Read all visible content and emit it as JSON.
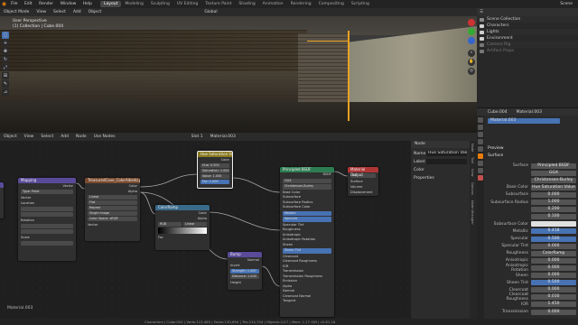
{
  "topbar": {
    "menus": [
      "File",
      "Edit",
      "Render",
      "Window",
      "Help"
    ],
    "tabs": [
      "Layout",
      "Modeling",
      "Sculpting",
      "UV Editing",
      "Texture Paint",
      "Shading",
      "Animation",
      "Rendering",
      "Compositing",
      "Scripting"
    ],
    "active_tab": "Layout",
    "scene": "Scene"
  },
  "viewport": {
    "mode": "Object Mode",
    "menus": [
      "View",
      "Select",
      "Add",
      "Object"
    ],
    "orientation": "Global",
    "label": "User Perspective",
    "label2": "(1) Collection | Cube.004"
  },
  "outliner": {
    "title": "Scene Collection",
    "items": [
      {
        "name": "Scene Collection",
        "color": "#8a8a8a"
      },
      {
        "name": "Characters",
        "color": "#d0d0d0"
      },
      {
        "name": "Lights",
        "color": "#d0d0d0"
      },
      {
        "name": "Environment",
        "color": "#d0d0d0"
      },
      {
        "name": "Camera Rig",
        "color": "#777777"
      },
      {
        "name": "Artifact Props",
        "color": "#777777"
      }
    ]
  },
  "properties": {
    "object": "Cube.004",
    "material": "Material.003",
    "slot": "Material.003",
    "surface_label": "Surface",
    "preview_label": "Preview",
    "rows": [
      {
        "label": "Surface",
        "value": "Principled BSDF",
        "style": "plain"
      },
      {
        "label": "",
        "value": "GGX",
        "style": "plain"
      },
      {
        "label": "",
        "value": "Christensen-Burley",
        "style": "plain"
      },
      {
        "label": "Base Color",
        "value": "Hue Saturation Value",
        "style": "plain"
      },
      {
        "label": "Subsurface",
        "value": "0.000",
        "style": "plain"
      },
      {
        "label": "Subsurface Radius",
        "value": "1.000",
        "style": "plain"
      },
      {
        "label": "",
        "value": "0.200",
        "style": "plain"
      },
      {
        "label": "",
        "value": "0.100",
        "style": "plain"
      },
      {
        "label": "Subsurface Color",
        "value": "",
        "style": "white"
      },
      {
        "label": "Metallic",
        "value": "0.418",
        "style": "blue"
      },
      {
        "label": "Specular",
        "value": "0.500",
        "style": "blue"
      },
      {
        "label": "Specular Tint",
        "value": "0.000",
        "style": "plain"
      },
      {
        "label": "Roughness",
        "value": "ColorRamp",
        "style": "plain"
      },
      {
        "label": "Anisotropic",
        "value": "0.000",
        "style": "plain"
      },
      {
        "label": "Anisotropic Rotation",
        "value": "0.000",
        "style": "plain"
      },
      {
        "label": "Sheen",
        "value": "0.000",
        "style": "plain"
      },
      {
        "label": "Sheen Tint",
        "value": "0.500",
        "style": "blue"
      },
      {
        "label": "Clearcoat",
        "value": "0.000",
        "style": "plain"
      },
      {
        "label": "Clearcoat Roughness",
        "value": "0.030",
        "style": "plain"
      },
      {
        "label": "IOR",
        "value": "1.450",
        "style": "plain"
      },
      {
        "label": "Transmission",
        "value": "0.000",
        "style": "plain"
      }
    ]
  },
  "node_editor": {
    "menus": [
      "Object",
      "View",
      "Select",
      "Add",
      "Node"
    ],
    "use_nodes": "Use Nodes",
    "slot": "Slot 1",
    "material": "Material.003",
    "footer": "Material.003",
    "sidebar": {
      "title": "Node",
      "name_label": "Name:",
      "name_value": "Hue Saturation Value",
      "label_label": "Label:",
      "color": "Color",
      "properties": "Properties",
      "tabs": [
        "Node",
        "Tool",
        "View",
        "Options",
        "Node Wrangler"
      ]
    },
    "nodes": {
      "mapping": {
        "title": "Mapping",
        "rows": [
          "Vector",
          "Type: Point",
          "Vector",
          "Location",
          "Rotation",
          "Scale"
        ]
      },
      "image_tex": {
        "title": "TreasuredCave_ColorAlbedo.png",
        "rows": [
          "Color",
          "Alpha",
          "Linear",
          "Flat",
          "Repeat",
          "Single Image",
          "Color Space: sRGB",
          "Vector"
        ]
      },
      "hsv": {
        "title": "Hue Saturation Value",
        "rows": [
          "Color",
          "Hue: 0.500",
          "Saturation: 1.000",
          "Value: 1.000",
          "Fac: 1.000",
          "Color"
        ]
      },
      "colorramp": {
        "title": "ColorRamp",
        "rows": [
          "Color",
          "Alpha",
          "RGB",
          "Linear",
          "Fac"
        ]
      },
      "bump": {
        "title": "Bump",
        "rows": [
          "Normal",
          "Invert",
          "Strength: 1.000",
          "Distance: 1.000",
          "Height",
          "Normal"
        ]
      },
      "bsdf": {
        "title": "Principled BSDF",
        "rows": [
          "BSDF",
          "GGX",
          "Christensen-Burley",
          "Base Color",
          "Subsurface",
          "Subsurface Radius",
          "Subsurface Color",
          "Metallic",
          "Specular",
          "Specular Tint",
          "Roughness",
          "Anisotropic",
          "Anisotropic Rotation",
          "Sheen",
          "Sheen Tint",
          "Clearcoat",
          "Clearcoat Roughness",
          "IOR",
          "Transmission",
          "Transmission Roughness",
          "Emission",
          "Alpha",
          "Normal",
          "Clearcoat Normal",
          "Tangent"
        ]
      },
      "output": {
        "title": "Material Output",
        "rows": [
          "All",
          "Surface",
          "Volume",
          "Displacement"
        ]
      }
    }
  },
  "statusbar": {
    "text": "Characters | Cube.004 | Verts:113,485 | Faces:130,694 | Tris:214,754 | Objects:1/27 | Mem: 1.17 GiB | v2.81.16"
  },
  "colors": {
    "accent": "#4772b3",
    "orange": "#e87d0d",
    "texture_node": "#7a4a2e",
    "shader_node": "#2e7d52",
    "output_node": "#b03636",
    "vector_node": "#5a4a9a",
    "converter_node": "#3a6a8a"
  }
}
